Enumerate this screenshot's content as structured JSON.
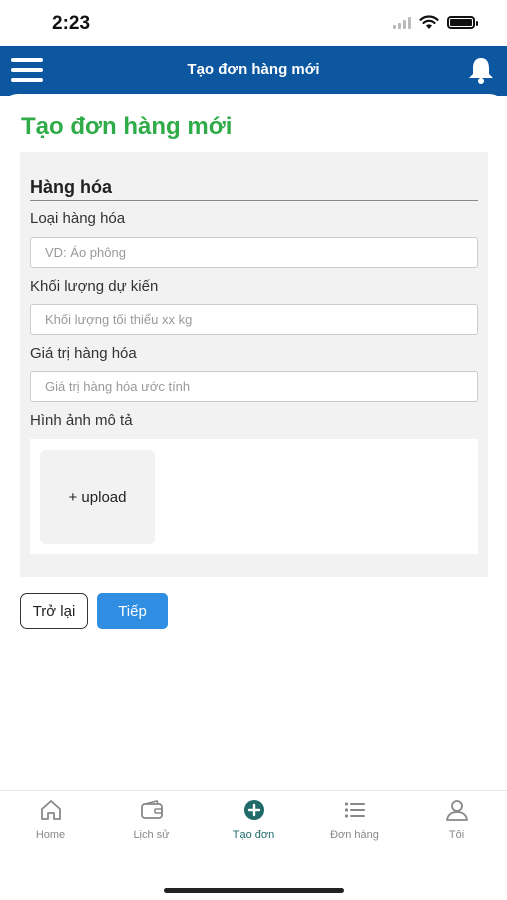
{
  "status_bar": {
    "time": "2:23"
  },
  "header": {
    "title": "Tạo đơn hàng mới"
  },
  "page": {
    "title": "Tạo đơn hàng mới"
  },
  "form": {
    "section_title": "Hàng hóa",
    "goods_type": {
      "label": "Loại hàng hóa",
      "placeholder": "VD: Áo phông"
    },
    "weight": {
      "label": "Khối lượng dự kiến",
      "placeholder": "Khối lượng tối thiểu xx kg"
    },
    "value": {
      "label": "Giá trị hàng hóa",
      "placeholder": "Giá trị hàng hóa ước tính"
    },
    "images": {
      "label": "Hình ảnh mô tả",
      "upload_label": "+ upload"
    }
  },
  "actions": {
    "back_label": "Trở lại",
    "next_label": "Tiếp"
  },
  "colors": {
    "header_bg": "#0d56a0",
    "title_green": "#2fac47",
    "primary_button": "#2f8ee1",
    "active_tab": "#1f6b6b"
  },
  "bottom_nav": {
    "items": [
      {
        "label": "Home",
        "icon": "home-icon"
      },
      {
        "label": "Lịch sử",
        "icon": "wallet-icon"
      },
      {
        "label": "Tạo đơn",
        "icon": "plus-circle-icon",
        "active": true
      },
      {
        "label": "Đơn hàng",
        "icon": "list-icon"
      },
      {
        "label": "Tôi",
        "icon": "user-icon"
      }
    ]
  }
}
